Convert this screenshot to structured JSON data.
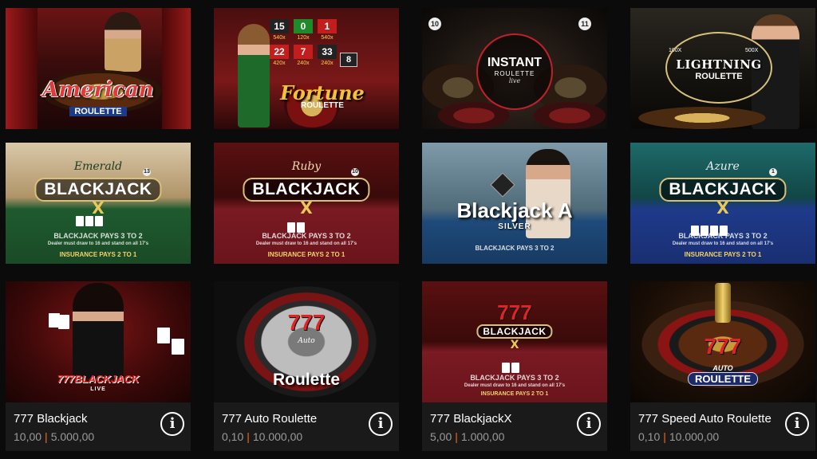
{
  "row1": [
    {
      "name": "American Roulette",
      "logo_line1": "American",
      "logo_line2": "ROULETTE"
    },
    {
      "name": "Fortune Roulette",
      "logo_line1": "Fortune",
      "logo_line2": "ROULETTE",
      "board": [
        "15",
        "0",
        "1",
        "22",
        "7",
        "33",
        "8"
      ],
      "mults": [
        "540x",
        "120x",
        "540x",
        "420x",
        "240x",
        "240x"
      ]
    },
    {
      "name": "Instant Roulette",
      "logo_line1": "INSTANT",
      "logo_line2": "ROULETTE",
      "logo_line3": "live",
      "nums": [
        "10",
        "11"
      ]
    },
    {
      "name": "Lightning Roulette",
      "logo_line1": "LIGHTNING",
      "logo_line2": "ROULETTE",
      "mults": [
        "100X",
        "500X"
      ]
    }
  ],
  "row2": [
    {
      "name": "Emerald Blackjack X",
      "script": "Emerald",
      "title": "BLACKJACK",
      "x": "X",
      "badge": "13",
      "felt1": "BLACKJACK PAYS 3 TO 2",
      "felt2": "Dealer must draw to 16 and stand on all 17's",
      "felt3": "INSURANCE PAYS 2 TO 1"
    },
    {
      "name": "Ruby Blackjack X",
      "script": "Ruby",
      "title": "BLACKJACK",
      "x": "X",
      "badge": "10",
      "felt1": "BLACKJACK PAYS 3 TO 2",
      "felt2": "Dealer must draw to 16 and stand on all 17's",
      "felt3": "INSURANCE PAYS 2 TO 1"
    },
    {
      "name": "Blackjack A Silver",
      "title": "Blackjack A",
      "subtitle": "SILVER",
      "felt1": "BLACKJACK PAYS 3 TO 2"
    },
    {
      "name": "Azure Blackjack X",
      "script": "Azure",
      "title": "BLACKJACK",
      "x": "X",
      "badge": "1",
      "felt1": "BLACKJACK PAYS 3 TO 2",
      "felt2": "Dealer must draw to 16 and stand on all 17's",
      "felt3": "INSURANCE PAYS 2 TO 1"
    }
  ],
  "row3": [
    {
      "title": "777 Blackjack",
      "min": "10,00",
      "max": "5.000,00",
      "sep": "|",
      "art_logo": "777BLACKJACK",
      "art_sub": "LIVE"
    },
    {
      "title": "777 Auto Roulette",
      "min": "0,10",
      "max": "10.000,00",
      "sep": "|",
      "art_777": "777",
      "art_auto": "Auto",
      "art_logo": "Roulette"
    },
    {
      "title": "777 BlackjackX",
      "min": "5,00",
      "max": "1.000,00",
      "sep": "|",
      "art_777": "777",
      "art_logo": "BLACKJACK",
      "art_x": "X",
      "felt1": "BLACKJACK PAYS 3 TO 2",
      "felt2": "Dealer must draw to 16 and stand on all 17's",
      "felt3": "INSURANCE PAYS 2 TO 1"
    },
    {
      "title": "777 Speed Auto Roulette",
      "min": "0,10",
      "max": "10.000,00",
      "sep": "|",
      "art_777": "777",
      "art_auto": "AUTO",
      "art_logo": "ROULETTE"
    }
  ],
  "info_glyph": "i",
  "colors": {
    "background": "#0b0b0b",
    "tile_bar": "#1a1a1a",
    "accent_separator": "#f06b1a",
    "limits_text": "#9a9a9a"
  }
}
